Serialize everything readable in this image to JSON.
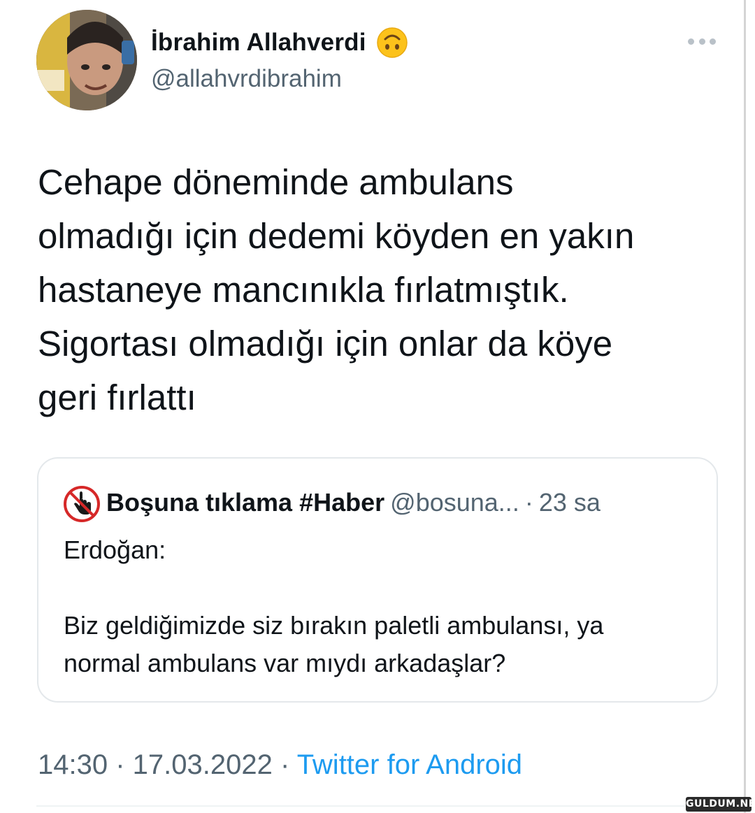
{
  "tweet": {
    "author": {
      "display_name": "İbrahim Allahverdi",
      "handle": "@allahvrdibrahim",
      "badge_icon": "upside-down-face-emoji-icon"
    },
    "more_icon": "more-options-icon",
    "text": "Cehape döneminde ambulans\nolmadığı için dedemi köyden en yakın\nhastaneye mancınıkla fırlatmıştık.\nSigortası olmadığı için onlar da köye\ngeri fırlattı",
    "quoted": {
      "avatar_icon": "no-click-hand-icon",
      "name": "Boşuna tıklama #Haber",
      "handle": "@bosuna...",
      "separator": "·",
      "time": "23 sa",
      "text": "Erdoğan:\n\nBiz geldiğimizde siz bırakın paletli ambulansı, ya\nnormal ambulans var mıydı arkadaşlar?"
    },
    "meta": {
      "time": "14:30",
      "separator": " · ",
      "date": "17.03.2022",
      "source": "Twitter for Android"
    }
  },
  "watermark": "GULDUM.NET",
  "colors": {
    "text": "#0f1419",
    "secondary": "#536471",
    "link": "#1d9bf0",
    "border": "#e4e8eb"
  }
}
